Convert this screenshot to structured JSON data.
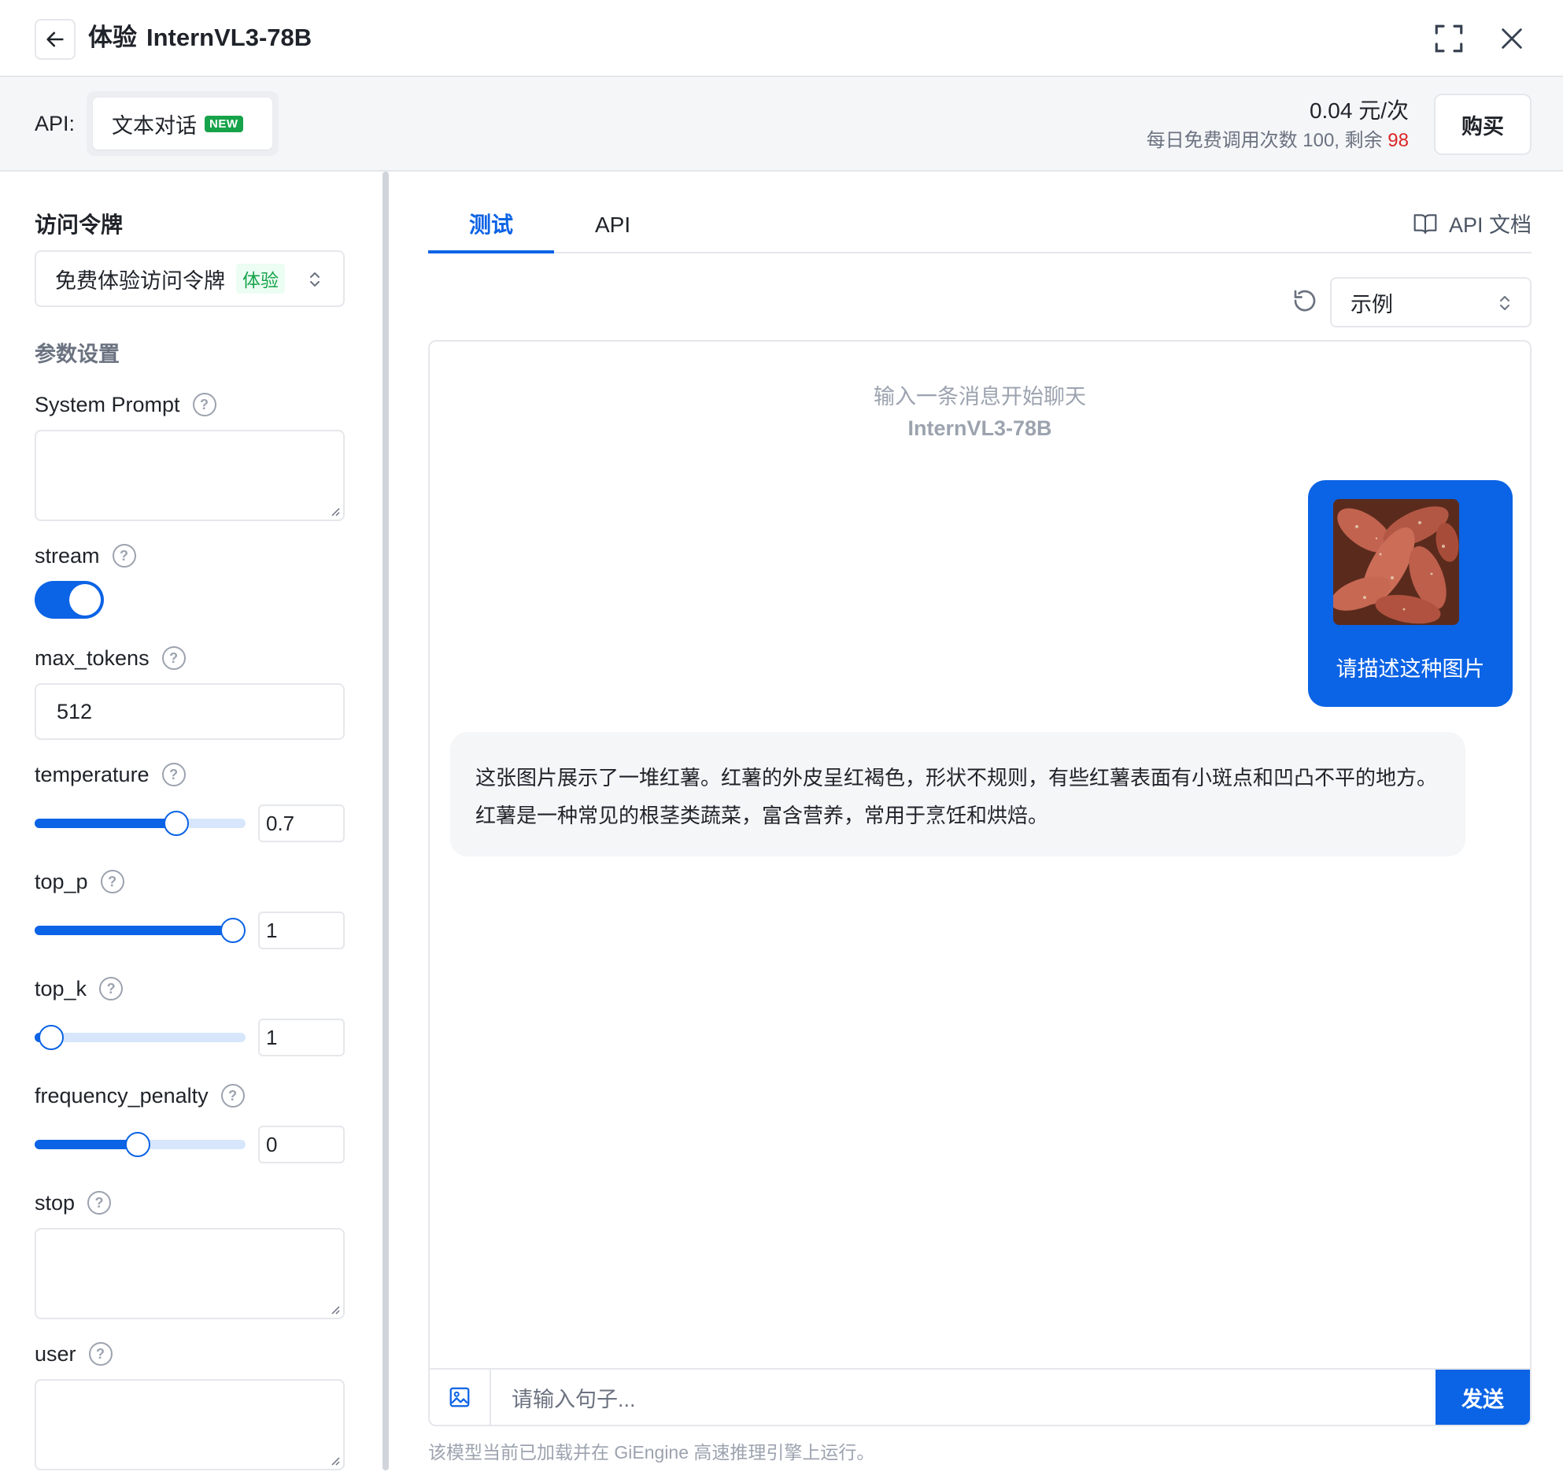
{
  "header": {
    "title_prefix": "体验",
    "model_name": "InternVL3-78B"
  },
  "api_bar": {
    "api_label": "API:",
    "api_option": "文本对话",
    "api_badge": "NEW",
    "price": "0.04 元/次",
    "free_quota_text": "每日免费调用次数 100, 剩余",
    "free_remaining": "98",
    "buy_label": "购买"
  },
  "left_panel": {
    "token_title": "访问令牌",
    "token_selected": "免费体验访问令牌",
    "token_tag": "体验",
    "params_title": "参数设置",
    "params": {
      "system_prompt": {
        "label": "System Prompt",
        "value": ""
      },
      "stream": {
        "label": "stream",
        "enabled": true
      },
      "max_tokens": {
        "label": "max_tokens",
        "value": "512"
      },
      "temperature": {
        "label": "temperature",
        "value": "0.7",
        "slider_fraction": 0.67
      },
      "top_p": {
        "label": "top_p",
        "value": "1",
        "slider_fraction": 0.94
      },
      "top_k": {
        "label": "top_k",
        "value": "1",
        "slider_fraction": 0.08
      },
      "frequency_penalty": {
        "label": "frequency_penalty",
        "value": "0",
        "slider_fraction": 0.49
      },
      "stop": {
        "label": "stop",
        "value": ""
      },
      "user": {
        "label": "user",
        "value": ""
      }
    }
  },
  "tabs": [
    {
      "label": "测试",
      "active": true
    },
    {
      "label": "API",
      "active": false
    }
  ],
  "api_doc_link": "API 文档",
  "example_select": "示例",
  "chat": {
    "hint_line1": "输入一条消息开始聊天",
    "hint_line2": "InternVL3-78B",
    "user_message": "请描述这种图片",
    "assistant_message": "这张图片展示了一堆红薯。红薯的外皮呈红褐色，形状不规则，有些红薯表面有小斑点和凹凸不平的地方。红薯是一种常见的根茎类蔬菜，富含营养，常用于烹饪和烘焙。",
    "input_placeholder": "请输入句子...",
    "send_label": "发送"
  },
  "footer_note": "该模型当前已加载并在 GiEngine 高速推理引擎上运行。",
  "colors": {
    "primary": "#0b63e5",
    "success": "#16a34a",
    "danger": "#dc2626"
  },
  "icons": [
    "back-arrow-icon",
    "fullscreen-icon",
    "close-icon",
    "chevron-updown-icon",
    "help-icon",
    "book-icon",
    "refresh-icon",
    "image-icon"
  ]
}
